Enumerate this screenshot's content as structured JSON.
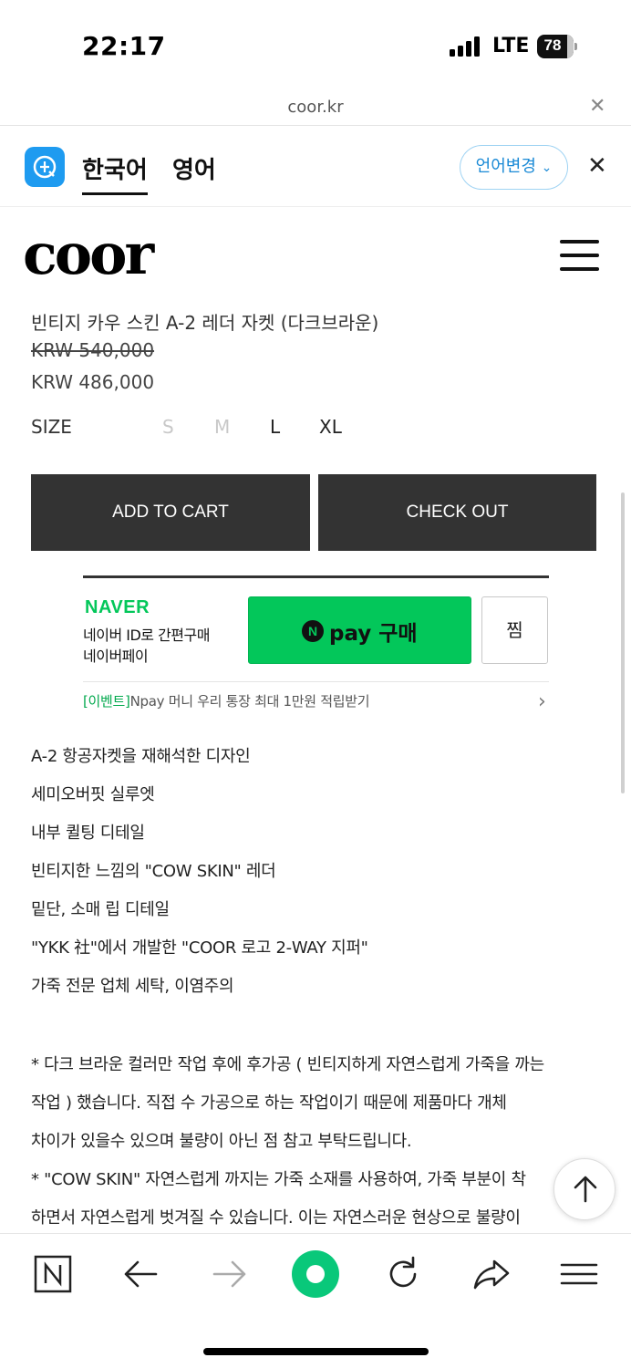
{
  "status": {
    "time": "22:17",
    "network": "LTE",
    "battery": "78"
  },
  "browser": {
    "url": "coor.kr"
  },
  "translate": {
    "tab_korean": "한국어",
    "tab_english": "영어",
    "change_language": "언어변경"
  },
  "site": {
    "logo": "coor"
  },
  "product": {
    "title": "빈티지 카우 스킨 A-2 레더 자켓 (다크브라운)",
    "original_price": "KRW 540,000",
    "sale_price": "KRW 486,000",
    "size_label": "SIZE",
    "sizes": [
      {
        "label": "S",
        "available": false
      },
      {
        "label": "M",
        "available": false
      },
      {
        "label": "L",
        "available": true
      },
      {
        "label": "XL",
        "available": true
      }
    ],
    "add_to_cart": "ADD TO CART",
    "check_out": "CHECK OUT"
  },
  "naver_pay": {
    "brand": "NAVER",
    "line1": "네이버 ID로 간편구매",
    "line2": "네이버페이",
    "button_label": "pay 구매",
    "button_icon": "N",
    "wish_label": "찜",
    "event_tag": "[이벤트]",
    "event_text": "Npay 머니 우리 통장 최대 1만원 적립받기"
  },
  "description": [
    "A-2 항공자켓을 재해석한 디자인",
    "세미오버핏 실루엣",
    "내부 퀼팅 디테일",
    "빈티지한 느낌의 \"COW SKIN\" 레더",
    "밑단, 소매 립 디테일",
    "\"YKK 社\"에서 개발한 \"COOR 로고 2-WAY 지퍼\"",
    "가죽 전문 업체 세탁, 이염주의",
    "",
    "* 다크 브라운 컬러만 작업 후에 후가공 ( 빈티지하게 자연스럽게 가죽을 까는",
    "작업 ) 했습니다. 직접 수 가공으로 하는 작업이기 때문에 제품마다 개체",
    "차이가 있을수 있으며 불량이 아닌 점 참고 부탁드립니다.",
    "* \"COW SKIN\" 자연스럽게 까지는 가죽 소재를 사용하여, 가죽 부분이 착",
    "하면서 자연스럽게 벗겨질 수 있습니다. 이는 자연스러운 현상으로 불량이"
  ],
  "colors": {
    "naver_green": "#03c75a",
    "button_dark": "#333333",
    "translate_blue": "#1e9bf0"
  }
}
